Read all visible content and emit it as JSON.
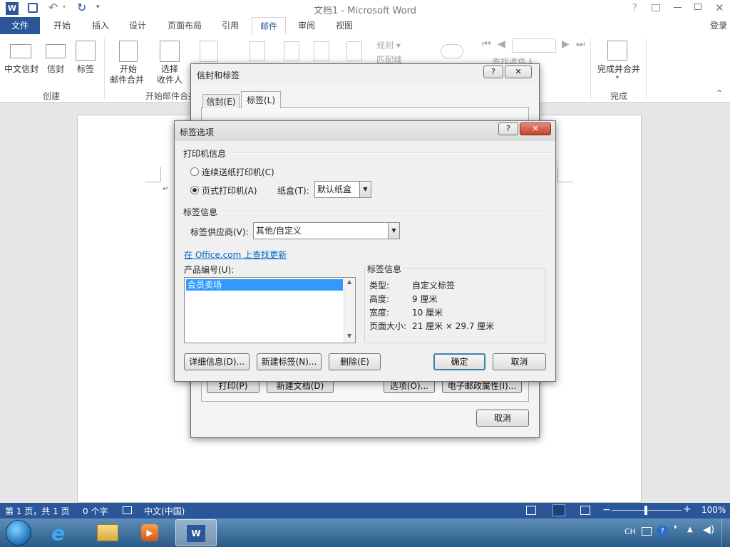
{
  "window": {
    "title": "文档1 - Microsoft Word",
    "login": "登录"
  },
  "ribbon_tabs": [
    "文件",
    "开始",
    "插入",
    "设计",
    "页面布局",
    "引用",
    "邮件",
    "审阅",
    "视图"
  ],
  "active_tab": "邮件",
  "ribbon": {
    "create": {
      "envelope_cn": "中文信封",
      "envelope": "信封",
      "label": "标签",
      "group": "创建"
    },
    "mailmerge": {
      "start_l1": "开始",
      "start_l2": "邮件合并",
      "select_l1": "选择",
      "select_l2": "收件人",
      "group": "开始邮件合并"
    },
    "rules": "规则",
    "match": "匹配域",
    "find_recipient": "查找收件人",
    "finish": {
      "label": "完成并合并",
      "group": "完成"
    }
  },
  "env_dialog": {
    "title": "信封和标签",
    "tabs": [
      "信封(E)",
      "标签(L)"
    ],
    "print_button": "打印(P)",
    "new_doc_button": "新建文档(D)",
    "options_button": "选项(O)...",
    "postage_button": "电子邮政属性(I)...",
    "cancel_button": "取消"
  },
  "label_dialog": {
    "title": "标签选项",
    "printer_info_heading": "打印机信息",
    "continuous_printer": "连续送纸打印机(C)",
    "page_printer": "页式打印机(A)",
    "tray_label": "纸盒(T):",
    "tray_value": "默认纸盒",
    "label_info_heading": "标签信息",
    "vendor_label": "标签供应商(V):",
    "vendor_value": "其他/自定义",
    "office_link": "在 Office.com 上查找更新",
    "product_number_label": "产品编号(U):",
    "product_items": [
      "会员卖场"
    ],
    "info_box_title": "标签信息",
    "info": [
      {
        "k": "类型:",
        "v": "自定义标签"
      },
      {
        "k": "高度:",
        "v": "9 厘米"
      },
      {
        "k": "宽度:",
        "v": "10 厘米"
      },
      {
        "k": "页面大小:",
        "v": "21 厘米 × 29.7 厘米"
      }
    ],
    "details_button": "详细信息(D)...",
    "new_label_button": "新建标签(N)...",
    "delete_button": "删除(E)",
    "ok_button": "确定",
    "cancel_button": "取消"
  },
  "statusbar": {
    "page": "第 1 页，共 1 页",
    "words": "0 个字",
    "language": "中文(中国)",
    "zoom": "100%",
    "zoom_level": 1.0
  },
  "taskbar": {
    "ime": "CH"
  },
  "colors": {
    "word_blue": "#2b579a",
    "link": "#0066cc",
    "selected": "#3399ff"
  }
}
